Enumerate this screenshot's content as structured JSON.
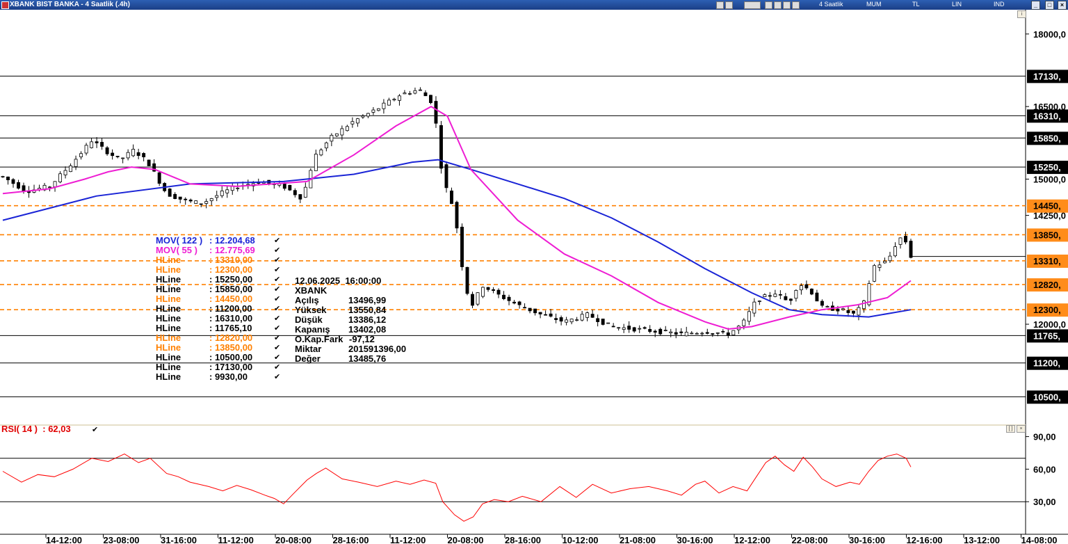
{
  "window": {
    "title": "XBANK BIST BANKA - 4 Saatlik (.4h)",
    "toolbar": {
      "period": "4 Saatlik",
      "style": "MUM",
      "currency": "TL",
      "scale": "LIN",
      "indicator": "IND"
    }
  },
  "chart_data": [
    {
      "type": "candlestick",
      "title": "XBANK BIST BANKA - 4 Saatlik (.4h)",
      "ylim": [
        9930,
        18300
      ],
      "y_ticks": [
        12000,
        14250,
        15000,
        16500,
        18000
      ],
      "y_tick_labels": [
        "12000,0",
        "14250,0",
        "15000,0",
        "16500,0",
        "18000,0"
      ],
      "x_tick_labels": [
        "14-12:00",
        "23-08:00",
        "31-16:00",
        "11-12:00",
        "20-08:00",
        "28-16:00",
        "11-12:00",
        "20-08:00",
        "28-16:00",
        "10-12:00",
        "21-08:00",
        "30-16:00",
        "12-12:00",
        "22-08:00",
        "30-16:00",
        "12-16:00",
        "13-12:00",
        "14-08:00"
      ],
      "candle_count": 175,
      "price_path": [
        [
          0,
          15050
        ],
        [
          10,
          14750
        ],
        [
          20,
          14850
        ],
        [
          30,
          15350
        ],
        [
          38,
          15800
        ],
        [
          45,
          15550
        ],
        [
          50,
          15400
        ],
        [
          56,
          15600
        ],
        [
          62,
          15350
        ],
        [
          70,
          14700
        ],
        [
          78,
          14550
        ],
        [
          85,
          14500
        ],
        [
          93,
          14700
        ],
        [
          100,
          14850
        ],
        [
          110,
          14950
        ],
        [
          120,
          14850
        ],
        [
          128,
          14600
        ],
        [
          133,
          15450
        ],
        [
          140,
          15850
        ],
        [
          150,
          16200
        ],
        [
          160,
          16450
        ],
        [
          170,
          16750
        ],
        [
          178,
          16850
        ],
        [
          184,
          16560
        ],
        [
          188,
          15000
        ],
        [
          193,
          14350
        ],
        [
          197,
          12950
        ],
        [
          200,
          12350
        ],
        [
          205,
          12800
        ],
        [
          212,
          12600
        ],
        [
          220,
          12400
        ],
        [
          230,
          12200
        ],
        [
          240,
          12050
        ],
        [
          250,
          12200
        ],
        [
          260,
          11950
        ],
        [
          270,
          11900
        ],
        [
          280,
          11850
        ],
        [
          290,
          11800
        ],
        [
          300,
          11850
        ],
        [
          310,
          11800
        ],
        [
          316,
          12000
        ],
        [
          322,
          12500
        ],
        [
          330,
          12650
        ],
        [
          336,
          12450
        ],
        [
          340,
          12850
        ],
        [
          345,
          12700
        ],
        [
          350,
          12350
        ],
        [
          358,
          12300
        ],
        [
          364,
          12200
        ],
        [
          368,
          12450
        ],
        [
          372,
          13200
        ],
        [
          378,
          13300
        ],
        [
          383,
          13800
        ],
        [
          386,
          13700
        ],
        [
          388,
          13402
        ]
      ],
      "last_bar": {
        "date": "12.06.2025",
        "time": "16:00:00",
        "symbol": "XBANK",
        "Açılış": "13496,99",
        "Yüksek": "13550,84",
        "Düşük": "13386,12",
        "Kapanış": "13402,08",
        "O.Kap.Fark": "-97,12",
        "Miktar": "201591396,00",
        "Değer": "13485,76"
      },
      "series": [
        {
          "name": "MOV( 122 )",
          "value": "12.204,68",
          "color": "#1a24d6",
          "path": [
            [
              0,
              14150
            ],
            [
              40,
              14650
            ],
            [
              80,
              14900
            ],
            [
              120,
              14950
            ],
            [
              150,
              15100
            ],
            [
              175,
              15350
            ],
            [
              186,
              15400
            ],
            [
              200,
              15200
            ],
            [
              220,
              14900
            ],
            [
              240,
              14600
            ],
            [
              260,
              14200
            ],
            [
              280,
              13700
            ],
            [
              300,
              13150
            ],
            [
              320,
              12650
            ],
            [
              336,
              12300
            ],
            [
              350,
              12200
            ],
            [
              370,
              12150
            ],
            [
              388,
              12300
            ]
          ]
        },
        {
          "name": "MOV( 55 )",
          "value": "12.775,69",
          "color": "#ee1dd3",
          "path": [
            [
              0,
              14700
            ],
            [
              20,
              14800
            ],
            [
              35,
              15000
            ],
            [
              45,
              15150
            ],
            [
              55,
              15250
            ],
            [
              65,
              15200
            ],
            [
              80,
              14900
            ],
            [
              100,
              14850
            ],
            [
              130,
              14950
            ],
            [
              150,
              15500
            ],
            [
              168,
              16100
            ],
            [
              183,
              16500
            ],
            [
              190,
              16300
            ],
            [
              200,
              15200
            ],
            [
              220,
              14150
            ],
            [
              240,
              13450
            ],
            [
              260,
              13000
            ],
            [
              280,
              12450
            ],
            [
              300,
              12050
            ],
            [
              310,
              11900
            ],
            [
              320,
              11950
            ],
            [
              336,
              12150
            ],
            [
              350,
              12300
            ],
            [
              365,
              12400
            ],
            [
              378,
              12550
            ],
            [
              388,
              12900
            ]
          ]
        }
      ],
      "hlines": [
        {
          "value": 13310,
          "label": "13310,00",
          "dashed": true,
          "color": "#ff8000",
          "axis": "13310,"
        },
        {
          "value": 12300,
          "label": "12300,00",
          "dashed": true,
          "color": "#ff8000",
          "axis": "12300,"
        },
        {
          "value": 15250,
          "label": "15250,00",
          "dashed": false,
          "color": "#000000",
          "axis": "15250,"
        },
        {
          "value": 15850,
          "label": "15850,00",
          "dashed": false,
          "color": "#000000",
          "axis": "15850,"
        },
        {
          "value": 14450,
          "label": "14450,00",
          "dashed": true,
          "color": "#ff8000",
          "axis": "14450,"
        },
        {
          "value": 11200,
          "label": "11200,00",
          "dashed": false,
          "color": "#000000",
          "axis": "11200,"
        },
        {
          "value": 16310,
          "label": "16310,00",
          "dashed": false,
          "color": "#000000",
          "axis": "16310,"
        },
        {
          "value": 11765.1,
          "label": "11765,10",
          "dashed": false,
          "color": "#000000",
          "axis": "11765,"
        },
        {
          "value": 12820,
          "label": "12820,00",
          "dashed": true,
          "color": "#ff8000",
          "axis": "12820,"
        },
        {
          "value": 13850,
          "label": "13850,00",
          "dashed": true,
          "color": "#ff8000",
          "axis": "13850,"
        },
        {
          "value": 10500,
          "label": "10500,00",
          "dashed": false,
          "color": "#000000",
          "axis": "10500,"
        },
        {
          "value": 17130,
          "label": "17130,00",
          "dashed": false,
          "color": "#000000",
          "axis": "17130,"
        },
        {
          "value": 9930,
          "label": "9930,00",
          "dashed": false,
          "color": "#000000",
          "axis": ""
        }
      ],
      "hline_name": "HLine"
    },
    {
      "type": "line",
      "title": "RSI( 14 )",
      "value": "62,03",
      "ylim": [
        0,
        100
      ],
      "y_ticks": [
        30,
        60,
        90
      ],
      "y_tick_labels": [
        "30,00",
        "60,00",
        "90,00"
      ],
      "levels": [
        30,
        70
      ],
      "series": [
        {
          "name": "RSI( 14 )",
          "color": "#ff0000",
          "path": [
            [
              0,
              58
            ],
            [
              8,
              48
            ],
            [
              15,
              55
            ],
            [
              22,
              53
            ],
            [
              30,
              60
            ],
            [
              38,
              70
            ],
            [
              45,
              67
            ],
            [
              52,
              74
            ],
            [
              58,
              66
            ],
            [
              63,
              70
            ],
            [
              70,
              56
            ],
            [
              75,
              53
            ],
            [
              80,
              48
            ],
            [
              88,
              44
            ],
            [
              94,
              40
            ],
            [
              100,
              45
            ],
            [
              106,
              41
            ],
            [
              112,
              36
            ],
            [
              116,
              33
            ],
            [
              120,
              28
            ],
            [
              124,
              37
            ],
            [
              130,
              50
            ],
            [
              134,
              56
            ],
            [
              138,
              61
            ],
            [
              145,
              51
            ],
            [
              152,
              48
            ],
            [
              160,
              44
            ],
            [
              168,
              49
            ],
            [
              174,
              46
            ],
            [
              180,
              50
            ],
            [
              185,
              47
            ],
            [
              188,
              30
            ],
            [
              193,
              18
            ],
            [
              197,
              12
            ],
            [
              201,
              16
            ],
            [
              205,
              28
            ],
            [
              210,
              32
            ],
            [
              216,
              30
            ],
            [
              222,
              35
            ],
            [
              230,
              30
            ],
            [
              238,
              44
            ],
            [
              245,
              34
            ],
            [
              252,
              46
            ],
            [
              260,
              38
            ],
            [
              268,
              42
            ],
            [
              276,
              44
            ],
            [
              284,
              40
            ],
            [
              290,
              36
            ],
            [
              296,
              46
            ],
            [
              300,
              49
            ],
            [
              306,
              38
            ],
            [
              312,
              44
            ],
            [
              318,
              40
            ],
            [
              322,
              53
            ],
            [
              326,
              66
            ],
            [
              330,
              72
            ],
            [
              334,
              64
            ],
            [
              338,
              58
            ],
            [
              342,
              71
            ],
            [
              346,
              62
            ],
            [
              350,
              51
            ],
            [
              356,
              44
            ],
            [
              362,
              48
            ],
            [
              366,
              46
            ],
            [
              370,
              58
            ],
            [
              374,
              68
            ],
            [
              378,
              72
            ],
            [
              382,
              74
            ],
            [
              386,
              70
            ],
            [
              388,
              62
            ]
          ]
        }
      ]
    }
  ]
}
